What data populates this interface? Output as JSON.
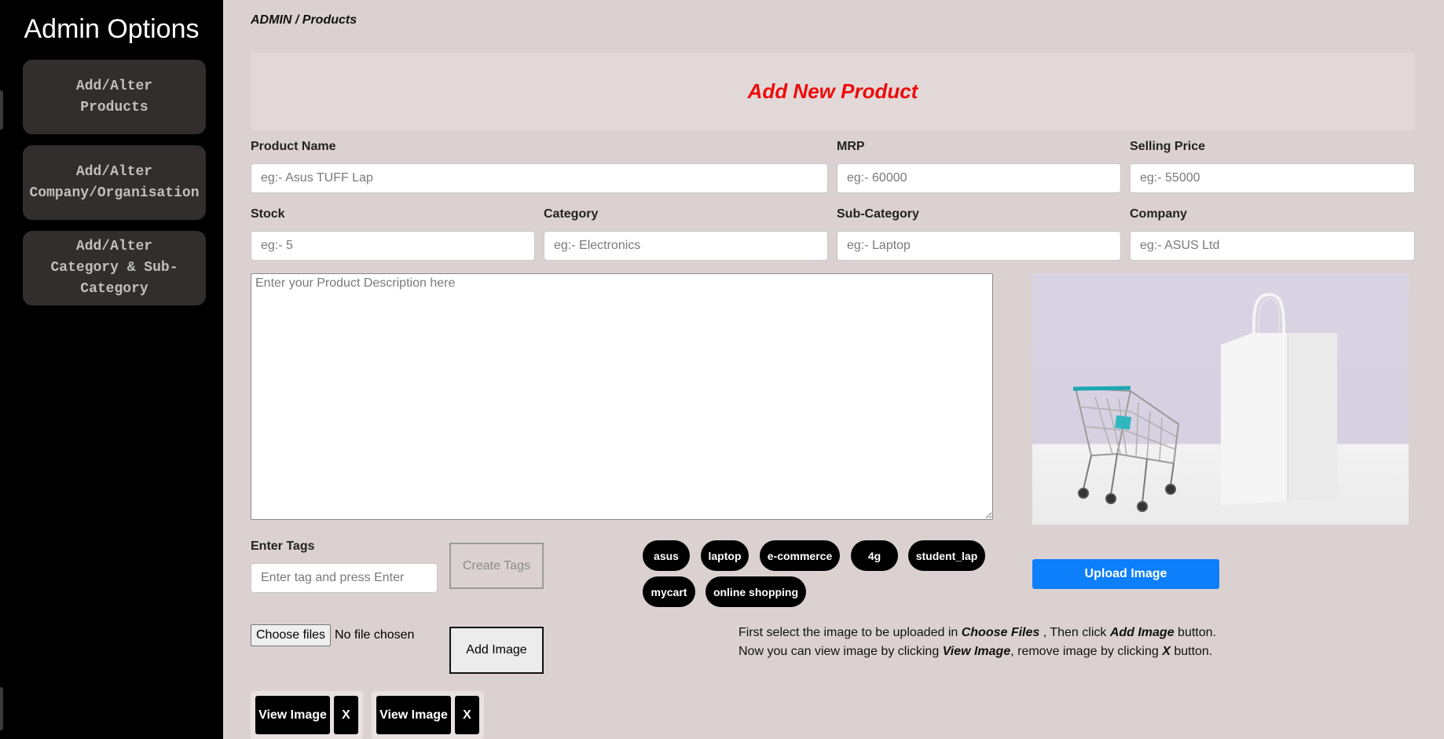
{
  "sidebar": {
    "title": "Admin Options",
    "items": [
      {
        "label": "Add/Alter Products"
      },
      {
        "label": "Add/Alter Company/Organisation"
      },
      {
        "label": "Add/Alter Category & Sub-Category"
      }
    ]
  },
  "breadcrumb": "ADMIN / Products",
  "banner_title": "Add New Product",
  "form": {
    "product_name": {
      "label": "Product Name",
      "placeholder": "eg:- Asus TUFF Lap"
    },
    "mrp": {
      "label": "MRP",
      "placeholder": "eg:- 60000"
    },
    "selling_price": {
      "label": "Selling Price",
      "placeholder": "eg:- 55000"
    },
    "stock": {
      "label": "Stock",
      "placeholder": "eg:- 5"
    },
    "category": {
      "label": "Category",
      "placeholder": "eg:- Electronics"
    },
    "sub_category": {
      "label": "Sub-Category",
      "placeholder": "eg:- Laptop"
    },
    "company": {
      "label": "Company",
      "placeholder": "eg:- ASUS Ltd"
    },
    "description": {
      "placeholder": "Enter your Product Description here"
    }
  },
  "tags": {
    "label": "Enter Tags",
    "placeholder": "Enter tag and press Enter",
    "create_button": "Create Tags",
    "items": [
      "asus",
      "laptop",
      "e-commerce",
      "4g",
      "student_lap",
      "mycart",
      "online shopping"
    ]
  },
  "upload_button": "Upload Image",
  "file_input": {
    "button": "Choose files",
    "status": "No file chosen"
  },
  "add_image_button": "Add Image",
  "info": {
    "line1_a": "First select the image to be uploaded in ",
    "line1_b": "Choose Files",
    "line1_c": " , Then click ",
    "line1_d": "Add Image",
    "line1_e": " button.",
    "line2_a": "Now you can view image by clicking ",
    "line2_b": "View Image",
    "line2_c": ", remove image by clicking ",
    "line2_d": "X",
    "line2_e": " button."
  },
  "image_chips": [
    {
      "view": "View Image",
      "remove": "X"
    },
    {
      "view": "View Image",
      "remove": "X"
    }
  ],
  "colors": {
    "accent_blue": "#0d7ffb",
    "title_red": "#ee0b0b",
    "page_bg": "#dcd1d1",
    "sidebar_bg": "#000000"
  },
  "icons": [
    "shopping-cart-image",
    "shopping-bag-image"
  ]
}
